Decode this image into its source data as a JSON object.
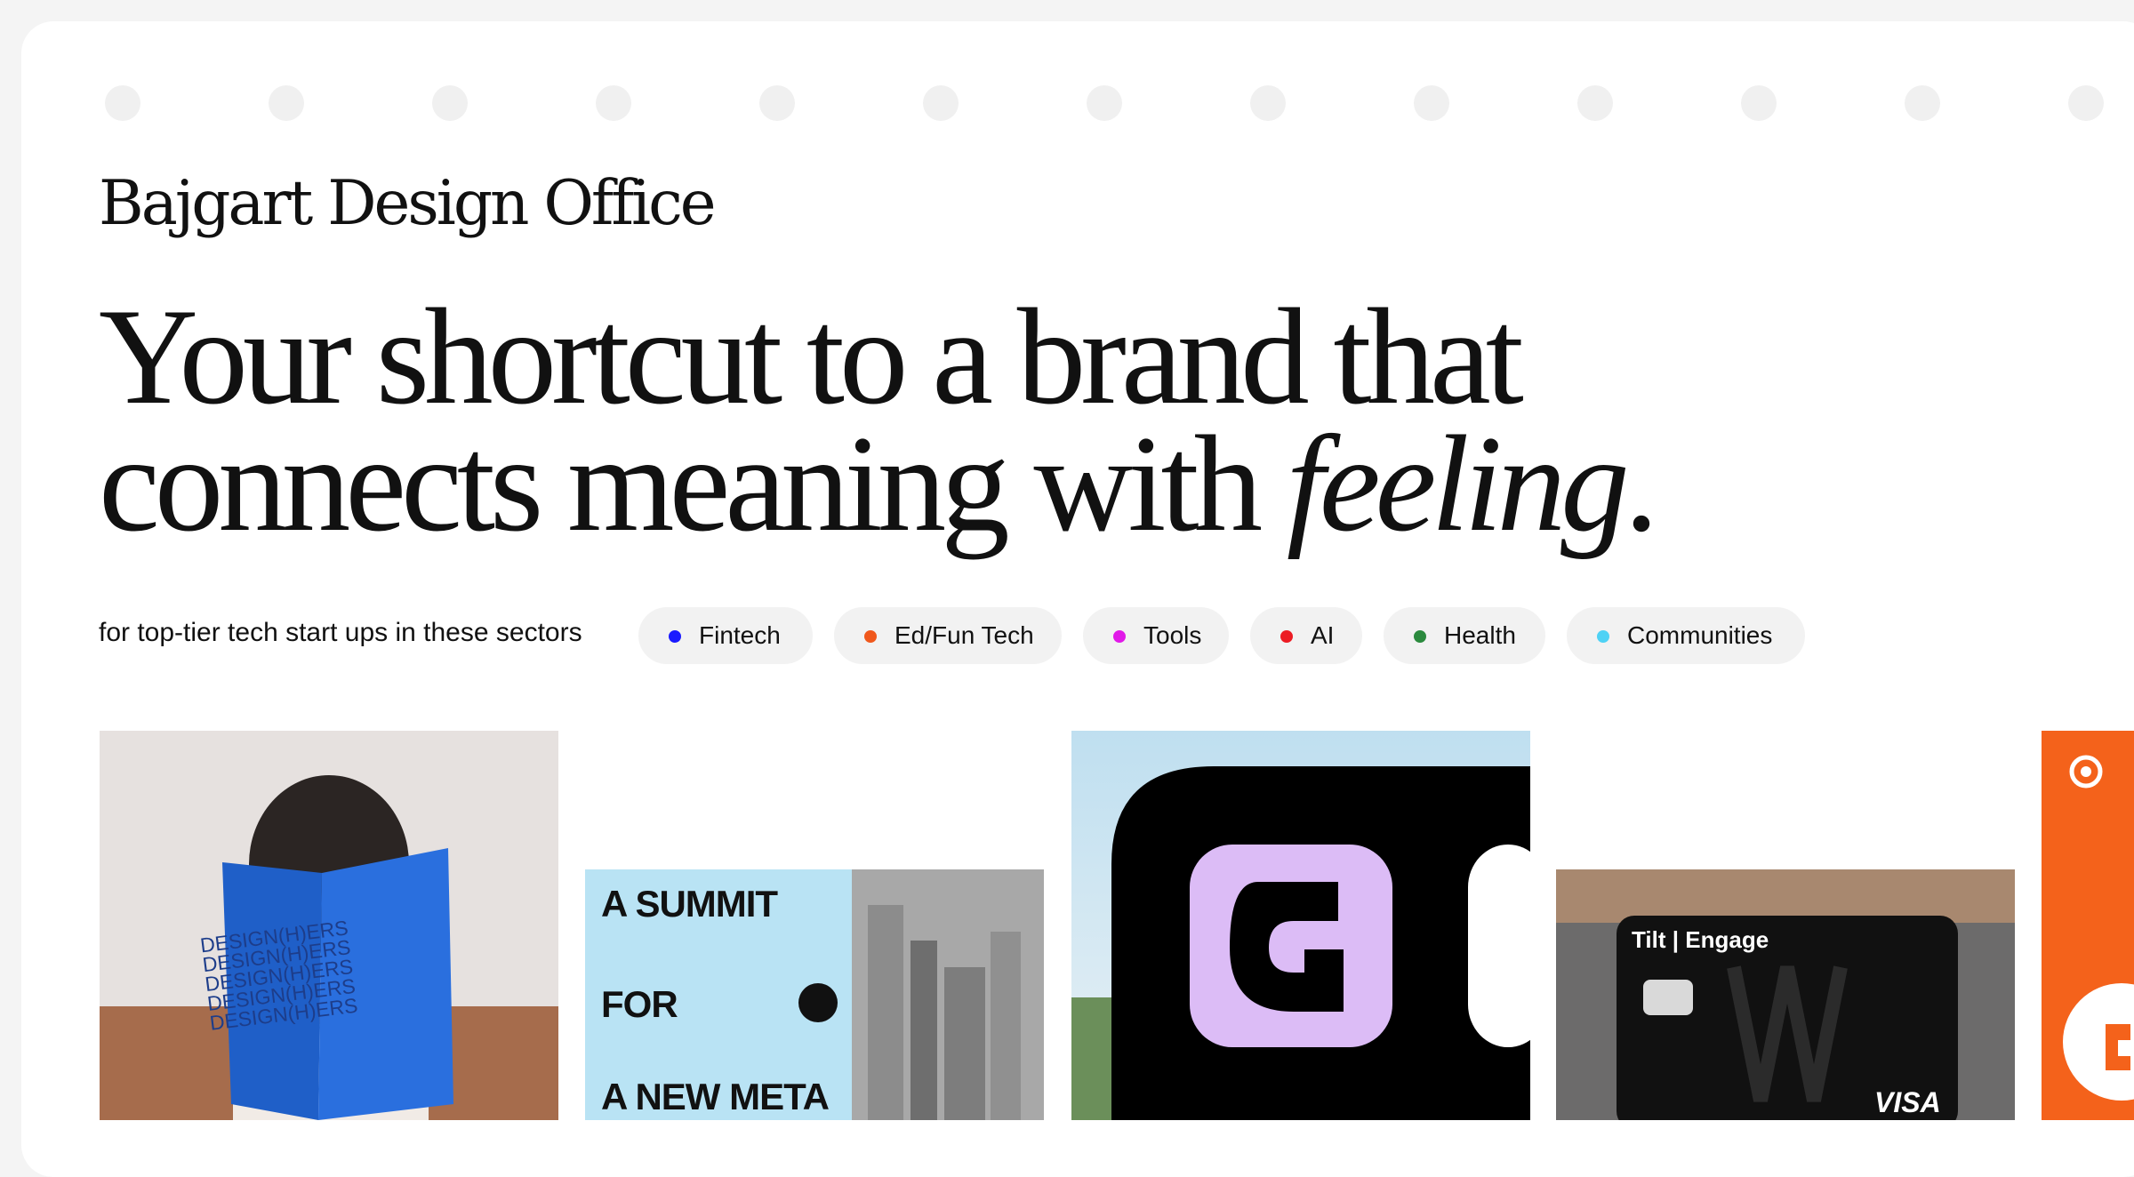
{
  "studio_name": "Bajgart Design Office",
  "headline": {
    "line1": "Your shortcut to a brand that",
    "line2_prefix": "connects meaning with ",
    "line2_emphasis": "feeling",
    "line2_suffix": "."
  },
  "sectors": {
    "label": "for top-tier tech start ups in these sectors",
    "items": [
      {
        "label": "Fintech",
        "color": "#1a1aff"
      },
      {
        "label": "Ed/Fun Tech",
        "color": "#f0581c"
      },
      {
        "label": "Tools",
        "color": "#e11ae8"
      },
      {
        "label": "AI",
        "color": "#ec1c24"
      },
      {
        "label": "Health",
        "color": "#2b8a3e"
      },
      {
        "label": "Communities",
        "color": "#4fd2f5"
      }
    ]
  },
  "showcase": {
    "book_text": "DESIGN(H)ERS\nDESIGN(H)ERS\nDESIGN(H)ERS\nDESIGN(H)ERS\nDESIGN(H)ERS",
    "summit": {
      "line1": "A SUMMIT",
      "line2": "FOR",
      "line3": "A NEW META"
    },
    "card": {
      "brand": "Tilt",
      "product": "Engage",
      "network": "VISA"
    }
  }
}
